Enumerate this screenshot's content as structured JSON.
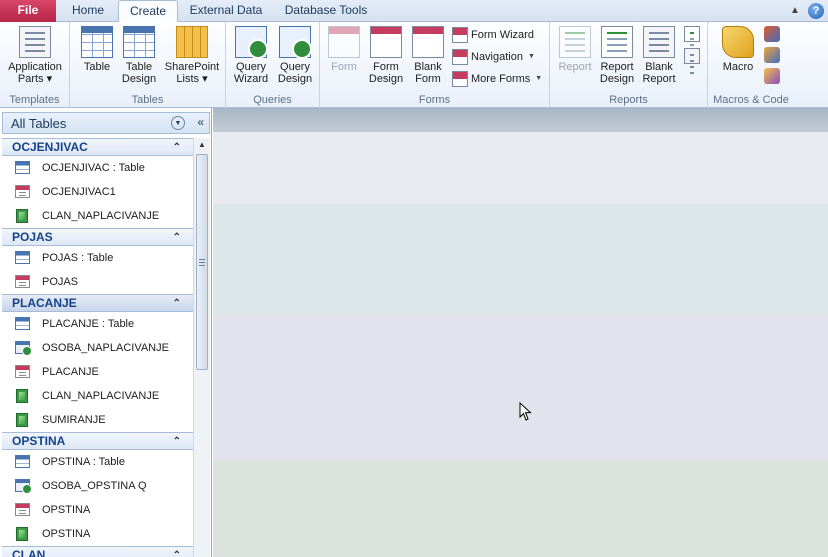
{
  "tabs": [
    {
      "label": "File"
    },
    {
      "label": "Home"
    },
    {
      "label": "Create"
    },
    {
      "label": "External Data"
    },
    {
      "label": "Database Tools"
    }
  ],
  "ribbon": {
    "groups": {
      "templates": "Templates",
      "tables": "Tables",
      "queries": "Queries",
      "forms": "Forms",
      "reports": "Reports",
      "macros": "Macros & Code"
    },
    "buttons": {
      "application_parts": "Application\nParts ▾",
      "table": "Table",
      "table_design": "Table\nDesign",
      "sharepoint_lists": "SharePoint\nLists ▾",
      "query_wizard": "Query\nWizard",
      "query_design": "Query\nDesign",
      "form": "Form",
      "form_design": "Form\nDesign",
      "blank_form": "Blank\nForm",
      "form_wizard": "Form Wizard",
      "navigation": "Navigation",
      "more_forms": "More Forms",
      "report": "Report",
      "report_design": "Report\nDesign",
      "blank_report": "Blank\nReport",
      "macro": "Macro"
    }
  },
  "nav": {
    "title": "All Tables",
    "groups": [
      {
        "name": "OCJENJIVAC",
        "items": [
          {
            "type": "table",
            "label": "OCJENJIVAC : Table"
          },
          {
            "type": "form",
            "label": "OCJENJIVAC1"
          },
          {
            "type": "report",
            "label": "CLAN_NAPLACIVANJE"
          }
        ]
      },
      {
        "name": "POJAS",
        "items": [
          {
            "type": "table",
            "label": "POJAS : Table"
          },
          {
            "type": "form",
            "label": "POJAS"
          }
        ]
      },
      {
        "name": "PLACANJE",
        "selected": true,
        "items": [
          {
            "type": "table",
            "label": "PLACANJE : Table"
          },
          {
            "type": "query",
            "label": "OSOBA_NAPLACIVANJE"
          },
          {
            "type": "form",
            "label": "PLACANJE"
          },
          {
            "type": "report",
            "label": "CLAN_NAPLACIVANJE"
          },
          {
            "type": "report",
            "label": "SUMIRANJE"
          }
        ]
      },
      {
        "name": "OPSTINA",
        "items": [
          {
            "type": "table",
            "label": "OPSTINA : Table"
          },
          {
            "type": "query",
            "label": "OSOBA_OPSTINA Q"
          },
          {
            "type": "form",
            "label": "OPSTINA"
          },
          {
            "type": "report",
            "label": "OPSTINA"
          }
        ]
      },
      {
        "name": "CLAN",
        "items": []
      }
    ]
  },
  "colors": {
    "file_tab": "#c42b4f",
    "accent_text": "#15428b",
    "ribbon_border": "#a7bcd8"
  }
}
